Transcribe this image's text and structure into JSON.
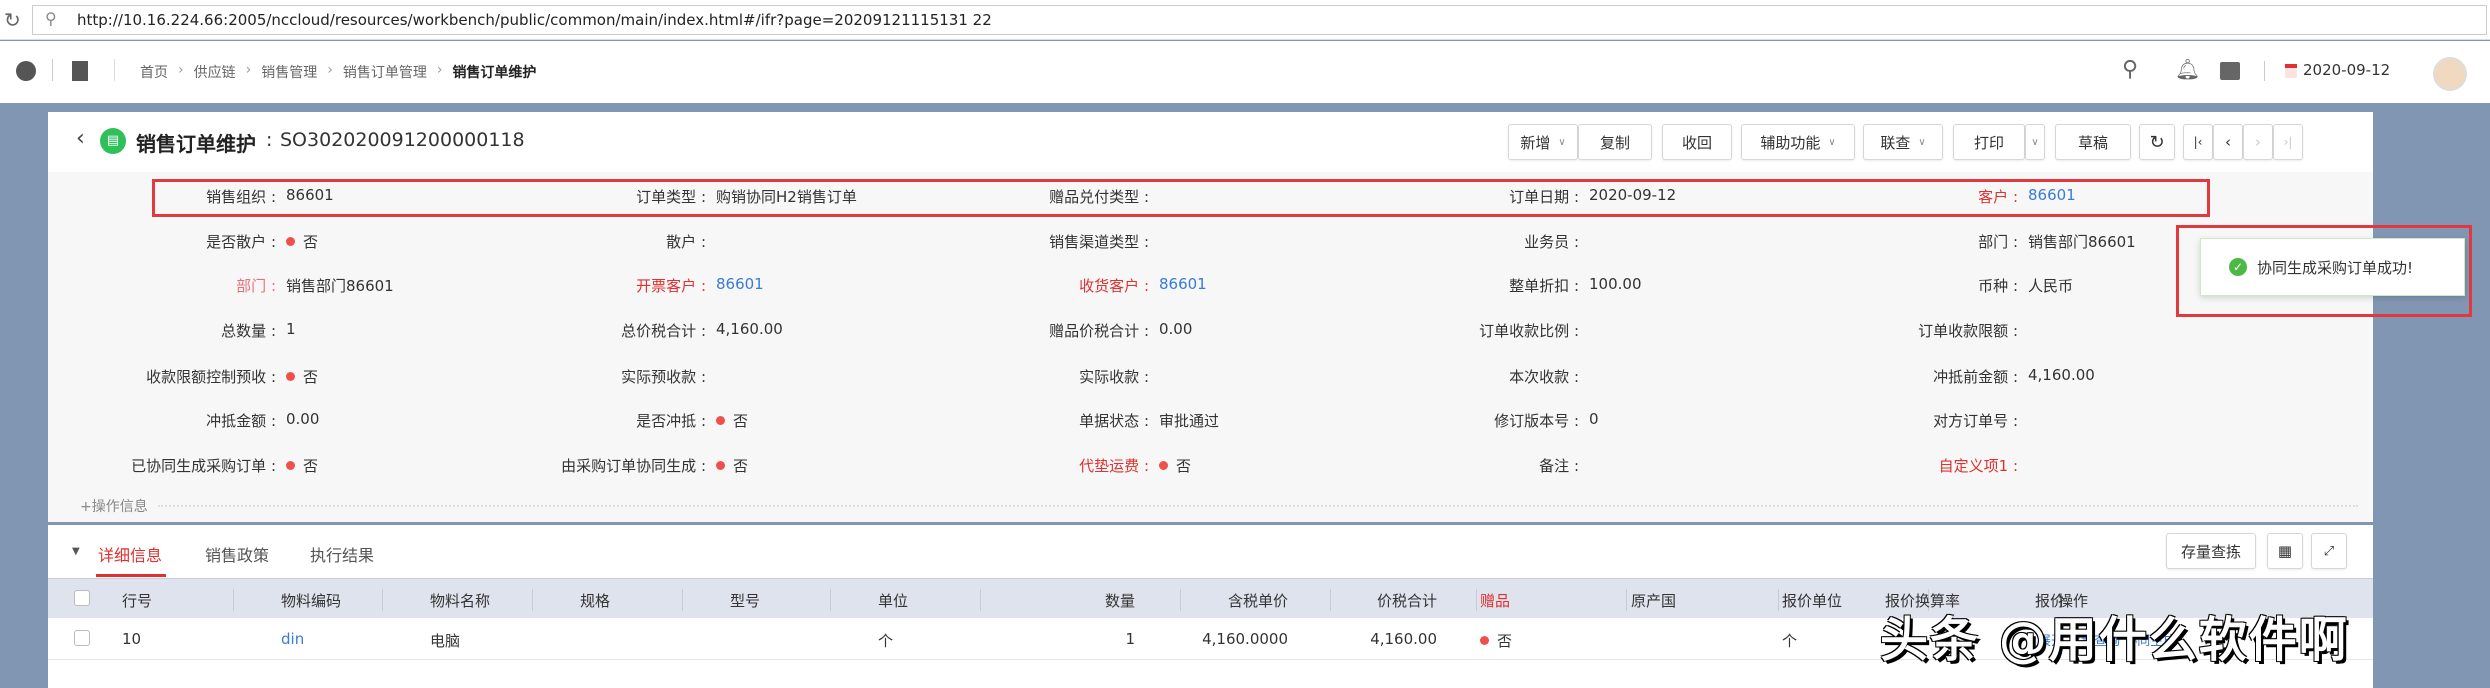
{
  "browser": {
    "url": "http://10.16.224.66:2005/nccloud/resources/workbench/public/common/main/index.html#/ifr?page=20209121115131 22"
  },
  "header": {
    "breadcrumbs": [
      "首页",
      "供应链",
      "销售管理",
      "销售订单管理",
      "销售订单维护"
    ],
    "date": "2020-09-12"
  },
  "page": {
    "title": "销售订单维护",
    "bill_no": "SO302020091200000118",
    "buttons": {
      "add": "新增",
      "copy": "复制",
      "recall": "收回",
      "assist": "辅助功能",
      "linkquery": "联查",
      "print": "打印",
      "draft": "草稿"
    }
  },
  "form": {
    "rows": [
      [
        {
          "label": "销售组织",
          "value": "86601"
        },
        {
          "label": "订单类型",
          "value": "购销协同H2销售订单"
        },
        {
          "label": "赠品兑付类型",
          "value": ""
        },
        {
          "label": "订单日期",
          "value": "2020-09-12"
        },
        {
          "label": "客户",
          "value": "86601",
          "required": true,
          "link": true
        }
      ],
      [
        {
          "label": "是否散户",
          "value": "否",
          "dot": true
        },
        {
          "label": "散户",
          "value": ""
        },
        {
          "label": "销售渠道类型",
          "value": ""
        },
        {
          "label": "业务员",
          "value": ""
        },
        {
          "label": "部门",
          "value": "销售部门86601"
        }
      ],
      [
        {
          "label": "部门",
          "value": "销售部门86601",
          "pink": true
        },
        {
          "label": "开票客户",
          "value": "86601",
          "required": true,
          "link": true
        },
        {
          "label": "收货客户",
          "value": "86601",
          "required": true,
          "link": true
        },
        {
          "label": "整单折扣",
          "value": "100.00"
        },
        {
          "label": "币种",
          "value": "人民币"
        }
      ],
      [
        {
          "label": "总数量",
          "value": "1"
        },
        {
          "label": "总价税合计",
          "value": "4,160.00"
        },
        {
          "label": "赠品价税合计",
          "value": "0.00"
        },
        {
          "label": "订单收款比例",
          "value": ""
        },
        {
          "label": "订单收款限额",
          "value": ""
        }
      ],
      [
        {
          "label": "收款限额控制预收",
          "value": "否",
          "dot": true
        },
        {
          "label": "实际预收款",
          "value": ""
        },
        {
          "label": "实际收款",
          "value": ""
        },
        {
          "label": "本次收款",
          "value": ""
        },
        {
          "label": "冲抵前金额",
          "value": "4,160.00"
        }
      ],
      [
        {
          "label": "冲抵金额",
          "value": "0.00"
        },
        {
          "label": "是否冲抵",
          "value": "否",
          "dot": true
        },
        {
          "label": "单据状态",
          "value": "审批通过"
        },
        {
          "label": "修订版本号",
          "value": "0"
        },
        {
          "label": "对方订单号",
          "value": ""
        }
      ],
      [
        {
          "label": "已协同生成采购订单",
          "value": "否",
          "dot": true
        },
        {
          "label": "由采购订单协同生成",
          "value": "否",
          "dot": true
        },
        {
          "label": "代垫运费",
          "value": "否",
          "dot": true,
          "required": true
        },
        {
          "label": "备注",
          "value": ""
        },
        {
          "label": "自定义项1",
          "value": "",
          "required": true
        }
      ]
    ],
    "op_info": "+操作信息"
  },
  "toast": {
    "message": "协同生成采购订单成功!"
  },
  "detail": {
    "tabs": [
      "详细信息",
      "销售政策",
      "执行结果"
    ],
    "stock_button": "存量查拣",
    "columns": [
      "行号",
      "物料编码",
      "物料名称",
      "规格",
      "型号",
      "单位",
      "数量",
      "含税单价",
      "价税合计",
      "赠品",
      "原产国",
      "报价单位",
      "报价换算率",
      "报价",
      "操作"
    ],
    "rows": [
      {
        "line": "10",
        "code": "din",
        "name": "电脑",
        "spec": "",
        "model": "",
        "unit": "个",
        "qty": "1",
        "price": "4,160.0000",
        "total": "4,160.00",
        "gift": "否",
        "origin": "",
        "quote_unit": "个",
        "actions": "展开 存量查询 协同生成"
      }
    ]
  },
  "watermark": "头条 @用什么软件啊"
}
